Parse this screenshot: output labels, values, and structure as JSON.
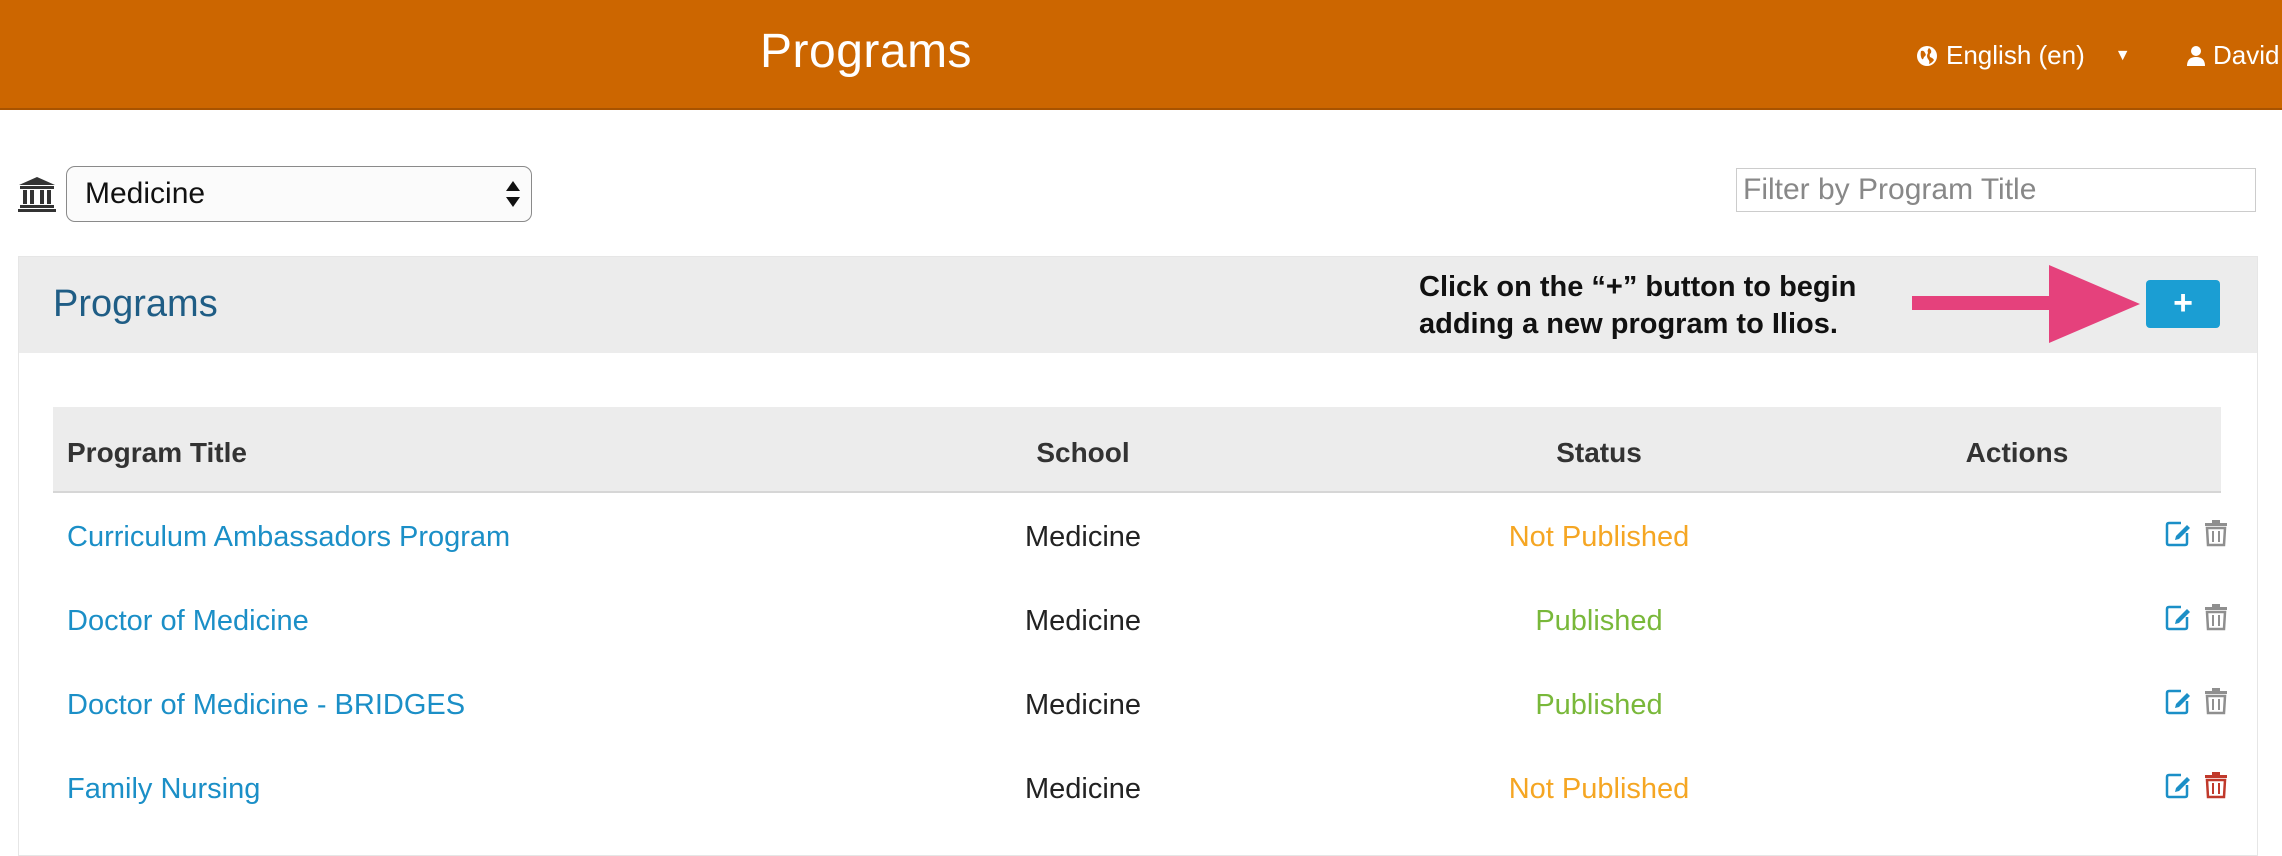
{
  "header": {
    "title": "Programs",
    "language": "English (en)",
    "user": "David"
  },
  "filters": {
    "school": "Medicine",
    "search_placeholder": "Filter by Program Title"
  },
  "panel": {
    "title": "Programs",
    "callout_line1": "Click on the “+” button to begin",
    "callout_line2": "adding a new program to Ilios.",
    "add_label": "+"
  },
  "table": {
    "headers": {
      "title": "Program Title",
      "school": "School",
      "status": "Status",
      "actions": "Actions"
    },
    "rows": [
      {
        "title": "Curriculum Ambassadors Program",
        "school": "Medicine",
        "status": "Not Published"
      },
      {
        "title": "Doctor of Medicine",
        "school": "Medicine",
        "status": "Published"
      },
      {
        "title": "Doctor of Medicine - BRIDGES",
        "school": "Medicine",
        "status": "Published"
      },
      {
        "title": "Family Nursing",
        "school": "Medicine",
        "status": "Not Published"
      }
    ]
  },
  "colors": {
    "header_bg": "#cc6600",
    "link": "#1b8fc7",
    "not_published": "#f5a623",
    "published": "#79b83a",
    "add_button": "#1b9ed3",
    "callout_arrow": "#e5417c",
    "delete_active": "#c0392b",
    "delete_disabled": "#8f8f8f"
  },
  "icons": {
    "language": "globe-icon",
    "user": "user-icon",
    "school": "institution-icon",
    "edit": "edit-icon",
    "delete": "trash-icon"
  }
}
